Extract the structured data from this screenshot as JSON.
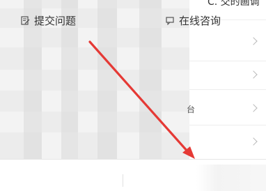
{
  "top_row": {
    "partial_text": "C. 交的画调"
  },
  "list_rows": [
    {
      "label": ""
    },
    {
      "label": ""
    },
    {
      "label": ""
    },
    {
      "label": ""
    }
  ],
  "partial_char": "台",
  "bottom_bar": {
    "submit_label": "提交问题",
    "submit_icon": "edit-doc-icon",
    "consult_label": "在线咨询",
    "consult_icon": "chat-bubble-icon"
  },
  "annotation": {
    "arrow_color": "#e53935"
  }
}
